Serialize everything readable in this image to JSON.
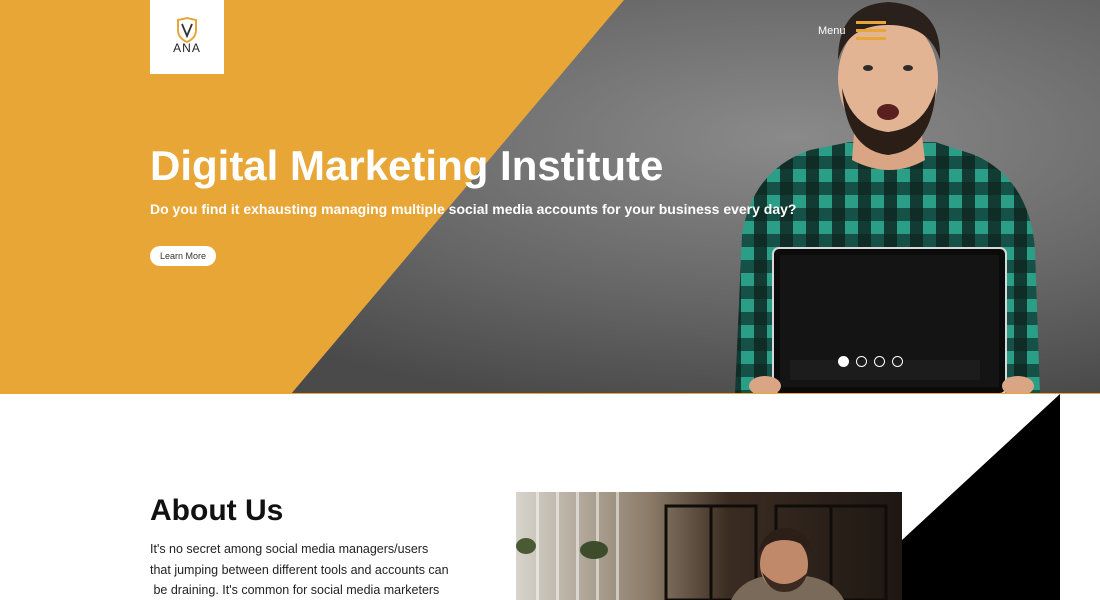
{
  "header": {
    "logo_text": "ANA",
    "menu_label": "Menu"
  },
  "hero": {
    "title": "Digital Marketing Institute",
    "subtitle": "Do you find it exhausting managing multiple social media accounts for your business every day?",
    "button_label": "Learn More",
    "slides_count": 4,
    "active_slide": 1
  },
  "about": {
    "title": "About Us",
    "lines": [
      "It's no secret among social media managers/users",
      "that jumping between different tools and accounts can",
      " be draining. It's common for social media marketers"
    ]
  },
  "colors": {
    "accent": "#e8a637",
    "hero_gray": "#6b6b6b",
    "dark": "#000000"
  },
  "icons": {
    "logo": "shield-logo-icon",
    "menu": "hamburger-menu-icon"
  }
}
